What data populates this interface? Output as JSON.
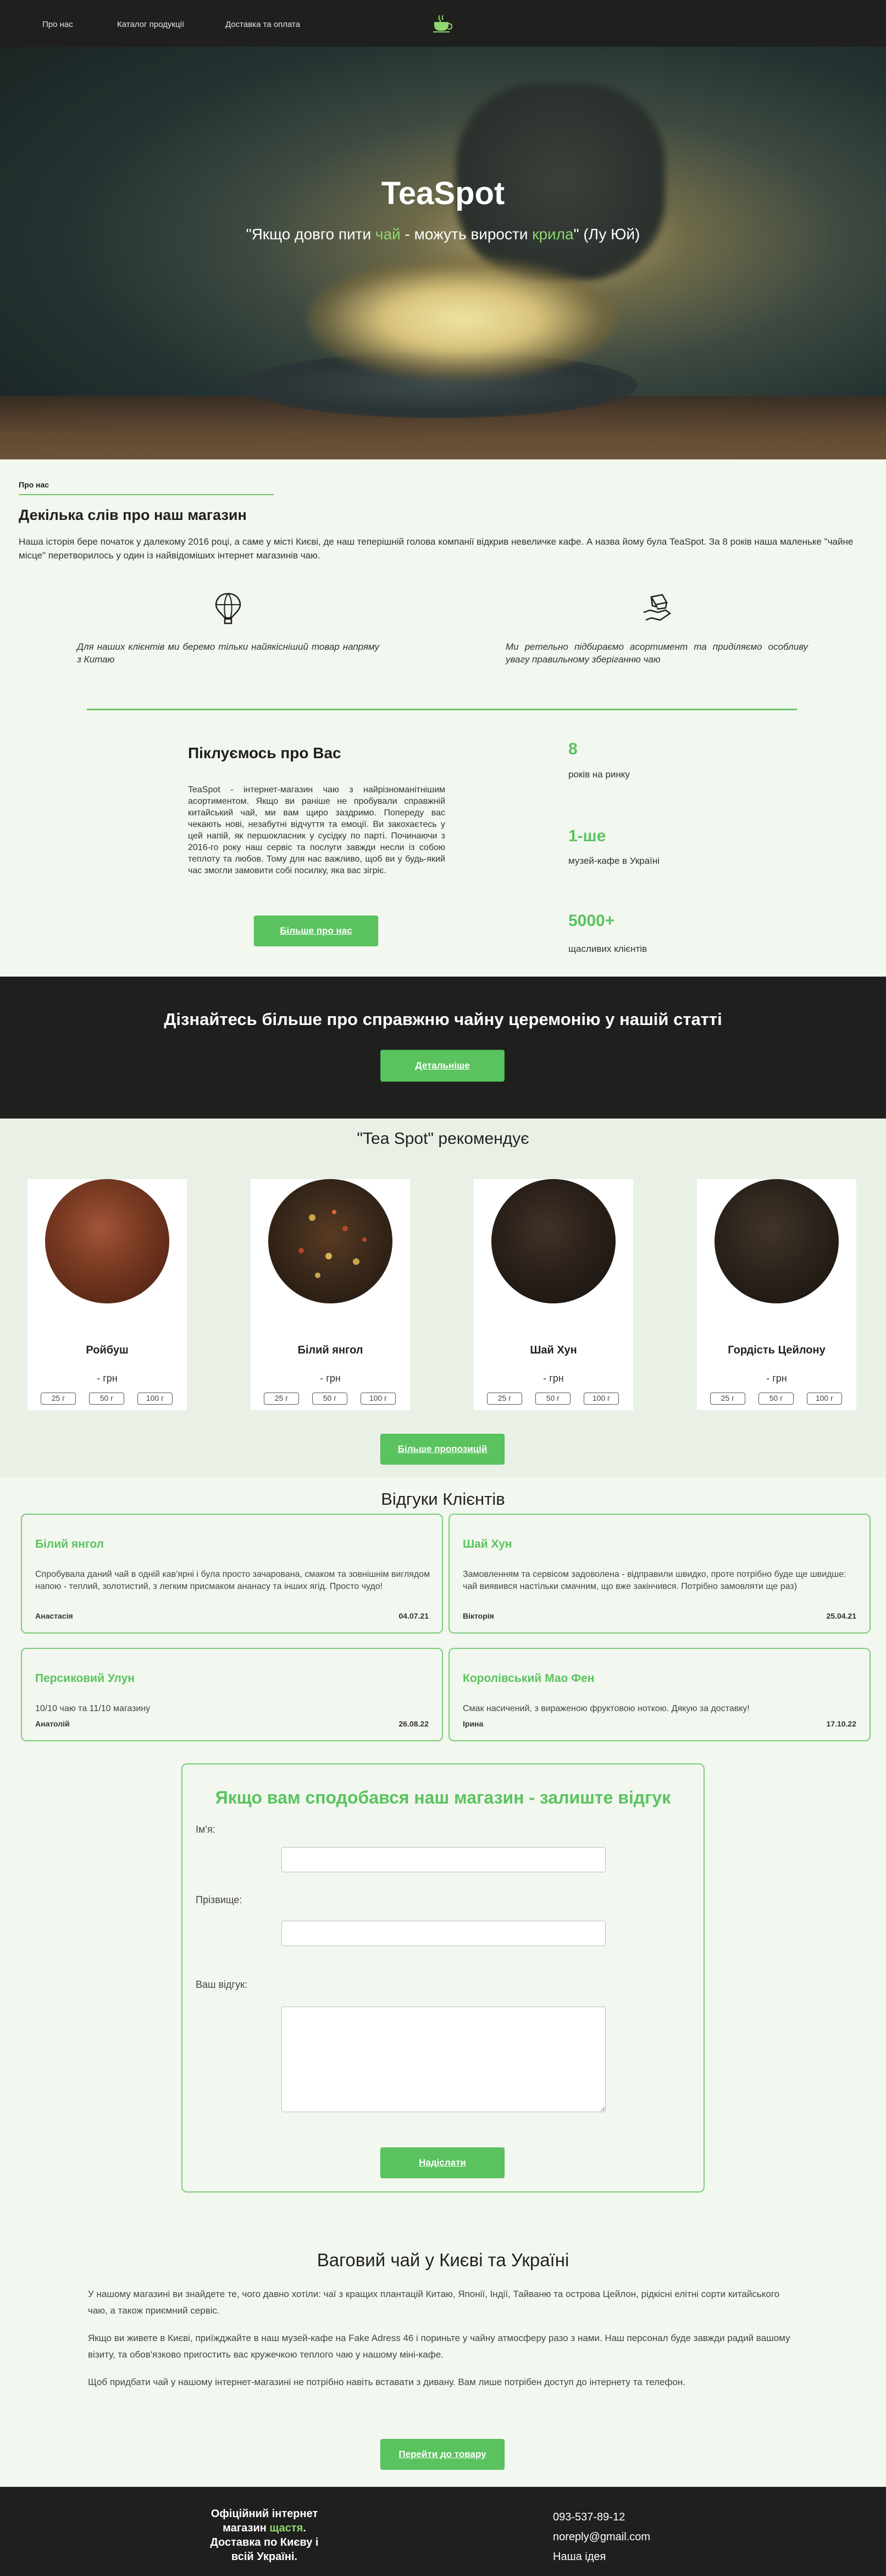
{
  "nav": {
    "items": [
      "Про нас",
      "Каталог продукції",
      "Доставка та оплата"
    ],
    "logo": "tea-cup-icon"
  },
  "hero": {
    "title": "TeaSpot",
    "quote_start": "\"Якщо довго пити ",
    "quote_w1": "чай",
    "quote_mid": " - можуть вирости ",
    "quote_w2": "крила",
    "quote_end": "\" (Лу Юй)"
  },
  "about": {
    "crumb": "Про нас",
    "title": "Декілька слів про наш магазин",
    "text": "Наша історія бере початок у далекому 2016 році, а саме у місті Києві, де наш теперішній голова компанії відкрив невеличке кафе. А назва йому була TeaSpot. За 8 років наша маленьке \"чайне місце\" перетворилось у один із найвідоміших інтернет магазинів чаю.",
    "feature1": "Для наших клієнтів ми беремо тільки найякісніший товар напряму з Китаю",
    "feature2": "Ми ретельно підбираємо асортимент та приділяємо особливу увагу правильному зберіганню чаю",
    "care_title": "Піклуємось про Вас",
    "care_text": "TeaSpot - інтернет-магазин чаю з найрізноманітнішим асортиментом. Якщо ви раніше не пробували справжній китайський чай, ми вам щиро заздримо. Попереду вас чекають нові, незабутні відчуття та емоції. Ви закохаєтесь у цей напій, як першокласник у сусідку по парті. Починаючи з 2016-го року наш сервіс та послуги завжди несли із собою теплоту та любов. Тому для нас важливо, щоб ви у будь-який час змогли замовити собі посилку, яка вас зігріє.",
    "care_button": "Більше про нас",
    "stats": [
      {
        "num": "8",
        "label": "років на ринку"
      },
      {
        "num": "1-ше",
        "label": "музей-кафе в Україні"
      },
      {
        "num": "5000+",
        "label": "щасливих клієнтів"
      }
    ]
  },
  "band": {
    "title": "Дізнайтесь більше про справжню чайну церемонію у нашій статті",
    "button": "Детальніше"
  },
  "recommend": {
    "title": "\"Tea Spot\" рекомендує",
    "products": [
      {
        "name": "Ройбуш",
        "price": "- грн",
        "color": "#7a3a22"
      },
      {
        "name": "Білий янгол",
        "price": "- грн",
        "color": "#3a2a1c"
      },
      {
        "name": "Шай Хун",
        "price": "- грн",
        "color": "#2b211a"
      },
      {
        "name": "Гордість Цейлону",
        "price": "- грн",
        "color": "#2c241c"
      }
    ],
    "weights": [
      "25 г",
      "50 г",
      "100 г"
    ],
    "more_button": "Більше пропозицій"
  },
  "reviews": {
    "title": "Відгуки Клієнтів",
    "items": [
      {
        "title": "Білий янгол",
        "text": "Спробувала даний чай в одній кав'ярні і була просто зачарована, смаком та зовнішнім виглядом напою - теплий, золотистий, з легким присмаком ананасу та інших ягід. Просто чудо!",
        "author": "Анастасія",
        "date": "04.07.21"
      },
      {
        "title": "Шай Хун",
        "text": "Замовленням та сервісом задоволена - відправили швидко, проте потрібно буде ще швидше: чай виявився настільки смачним, що вже закінчився. Потрібно замовляти ще раз)",
        "author": "Вікторія",
        "date": "25.04.21"
      },
      {
        "title": "Персиковий Улун",
        "text": "10/10 чаю та 11/10 магазину",
        "author": "Анатолій",
        "date": "26.08.22"
      },
      {
        "title": "Королівський Мао Фен",
        "text": "Смак насичений, з вираженою фруктовою ноткою. Дякую за доставку!",
        "author": "Ірина",
        "date": "17.10.22"
      }
    ]
  },
  "form": {
    "title": "Якщо вам сподобався наш магазин - залиште відгук",
    "name_label": "Ім'я:",
    "surname_label": "Прізвище:",
    "review_label": "Ваш відгук:",
    "submit": "Надіслати"
  },
  "seo": {
    "title": "Ваговий чай у Києві та Україні",
    "p1": "У нашому магазині ви знайдете те, чого давно хотіли: чаї з кращих плантацій Китаю, Японії, Індії, Тайваню та острова Цейлон, рідкісні елітні сорти китайського чаю, а також приємний сервіс.",
    "p2": "Якщо ви живете в Києві, приїжджайте в наш музей-кафе на Fake Adress 46 і пориньте у чайну атмосферу разо з нами. Наш персонал буде завжди радий вашому візиту, та обов'язково пригостить вас кружечкою теплого чаю у нашому міні-кафе.",
    "p3": "Щоб придбати чай у нашому інтернет-магазині не потрібно навіть вставати з дивану. Вам лише потрібен доступ до інтернету та телефон.",
    "button": "Перейти до товару"
  },
  "footer": {
    "slogan_a": "Офіційний інтернет магазин ",
    "slogan_g": "щастя",
    "slogan_b": ". Доставка по Києву і всій Україні.",
    "phone": "093-537-89-12",
    "email": "noreply@gmail.com",
    "idea": "Наша ідея"
  },
  "colors": {
    "accent": "#5ac35f",
    "dark": "#1f201e",
    "bg": "#f2f7ef"
  }
}
